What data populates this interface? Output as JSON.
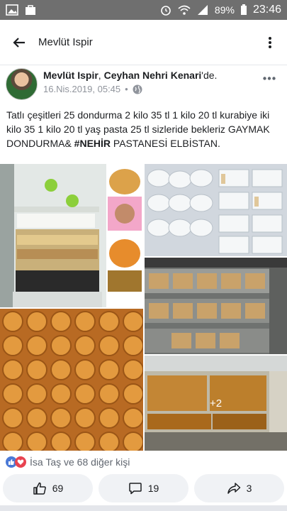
{
  "status_bar": {
    "battery": "89%",
    "time": "23:46",
    "icons": [
      "image-icon",
      "bag-icon",
      "alarm-icon",
      "wifi-icon",
      "signal-icon",
      "battery-icon"
    ]
  },
  "app_bar": {
    "title": "Mevlüt Ispir",
    "icons": [
      "back-arrow-icon",
      "more-vertical-icon"
    ]
  },
  "post": {
    "author": "Mevlüt Ispir",
    "place_sep": ", ",
    "location": "Ceyhan Nehri Kenari",
    "location_suffix": "'de.",
    "date": "16.Nis.2019, 05:45",
    "dot": "•",
    "text_before": "Tatlı çeşitleri 25 dondurma 2 kilo 35 tl 1 kilo 20 tl kurabiye iki kilo 35 1 kilo 20 tl yaş pasta 25 tl sizleride bekleriz GAYMAK DONDURMA& ",
    "hashtag": "#NEHİR",
    "text_after": " PASTANESİ ELBİSTAN.",
    "more_photos": "+2"
  },
  "reactions": {
    "summary": "İsa Taş ve 68 diğer kişi"
  },
  "actions": {
    "like_count": "69",
    "comment_count": "19",
    "share_count": "3"
  },
  "colors": {
    "status_bar": "#6f6f6f",
    "like_blue": "#4b79d6",
    "love_red": "#e84350",
    "button_bg": "#f0f2f5"
  }
}
